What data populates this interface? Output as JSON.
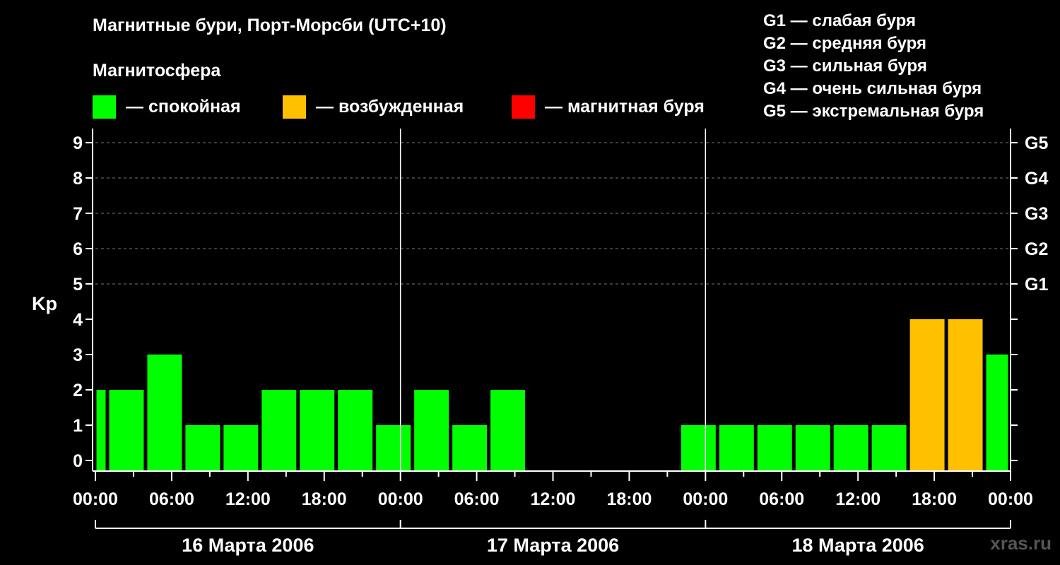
{
  "title": "Магнитные бури, Порт-Морсби (UTC+10)",
  "subtitle": "Магнитосфера",
  "legend": [
    {
      "label": "— спокойная",
      "color": "#00ff00"
    },
    {
      "label": "— возбужденная",
      "color": "#ffc000"
    },
    {
      "label": "— магнитная буря",
      "color": "#ff0000"
    }
  ],
  "g_scale": [
    "G1 — слабая буря",
    "G2 — средняя буря",
    "G3 — сильная буря",
    "G4 — очень сильная буря",
    "G5 — экстремальная буря"
  ],
  "watermark": "xras.ru",
  "chart_data": {
    "type": "bar",
    "ylabel": "Kp",
    "ylim": [
      0,
      9
    ],
    "yticks": [
      "0",
      "1",
      "2",
      "3",
      "4",
      "5",
      "6",
      "7",
      "8",
      "9"
    ],
    "right_ticks": [
      {
        "y": 5,
        "label": "G1"
      },
      {
        "y": 6,
        "label": "G2"
      },
      {
        "y": 7,
        "label": "G3"
      },
      {
        "y": 8,
        "label": "G4"
      },
      {
        "y": 9,
        "label": "G5"
      }
    ],
    "x_tick_labels": [
      "00:00",
      "06:00",
      "12:00",
      "18:00",
      "00:00",
      "06:00",
      "12:00",
      "18:00",
      "00:00",
      "06:00",
      "12:00",
      "18:00",
      "00:00"
    ],
    "days": [
      "16 Марта 2006",
      "17 Марта 2006",
      "18 Марта 2006"
    ],
    "bars": [
      {
        "start": 0,
        "end": 1,
        "value": 2,
        "status": "quiet"
      },
      {
        "start": 1,
        "end": 4,
        "value": 2,
        "status": "quiet"
      },
      {
        "start": 4,
        "end": 7,
        "value": 3,
        "status": "quiet"
      },
      {
        "start": 7,
        "end": 10,
        "value": 1,
        "status": "quiet"
      },
      {
        "start": 10,
        "end": 13,
        "value": 1,
        "status": "quiet"
      },
      {
        "start": 13,
        "end": 16,
        "value": 2,
        "status": "quiet"
      },
      {
        "start": 16,
        "end": 19,
        "value": 2,
        "status": "quiet"
      },
      {
        "start": 19,
        "end": 22,
        "value": 2,
        "status": "quiet"
      },
      {
        "start": 22,
        "end": 25,
        "value": 1,
        "status": "quiet"
      },
      {
        "start": 25,
        "end": 28,
        "value": 2,
        "status": "quiet"
      },
      {
        "start": 28,
        "end": 31,
        "value": 1,
        "status": "quiet"
      },
      {
        "start": 31,
        "end": 34,
        "value": 2,
        "status": "quiet"
      },
      {
        "start": 46,
        "end": 49,
        "value": 1,
        "status": "quiet"
      },
      {
        "start": 49,
        "end": 52,
        "value": 1,
        "status": "quiet"
      },
      {
        "start": 52,
        "end": 55,
        "value": 1,
        "status": "quiet"
      },
      {
        "start": 55,
        "end": 58,
        "value": 1,
        "status": "quiet"
      },
      {
        "start": 58,
        "end": 61,
        "value": 1,
        "status": "quiet"
      },
      {
        "start": 61,
        "end": 64,
        "value": 1,
        "status": "quiet"
      },
      {
        "start": 64,
        "end": 67,
        "value": 4,
        "status": "active"
      },
      {
        "start": 67,
        "end": 70,
        "value": 4,
        "status": "active"
      },
      {
        "start": 70,
        "end": 72,
        "value": 3,
        "status": "quiet"
      }
    ],
    "colors": {
      "quiet": "#00ff00",
      "active": "#ffc000",
      "storm": "#ff0000"
    }
  }
}
